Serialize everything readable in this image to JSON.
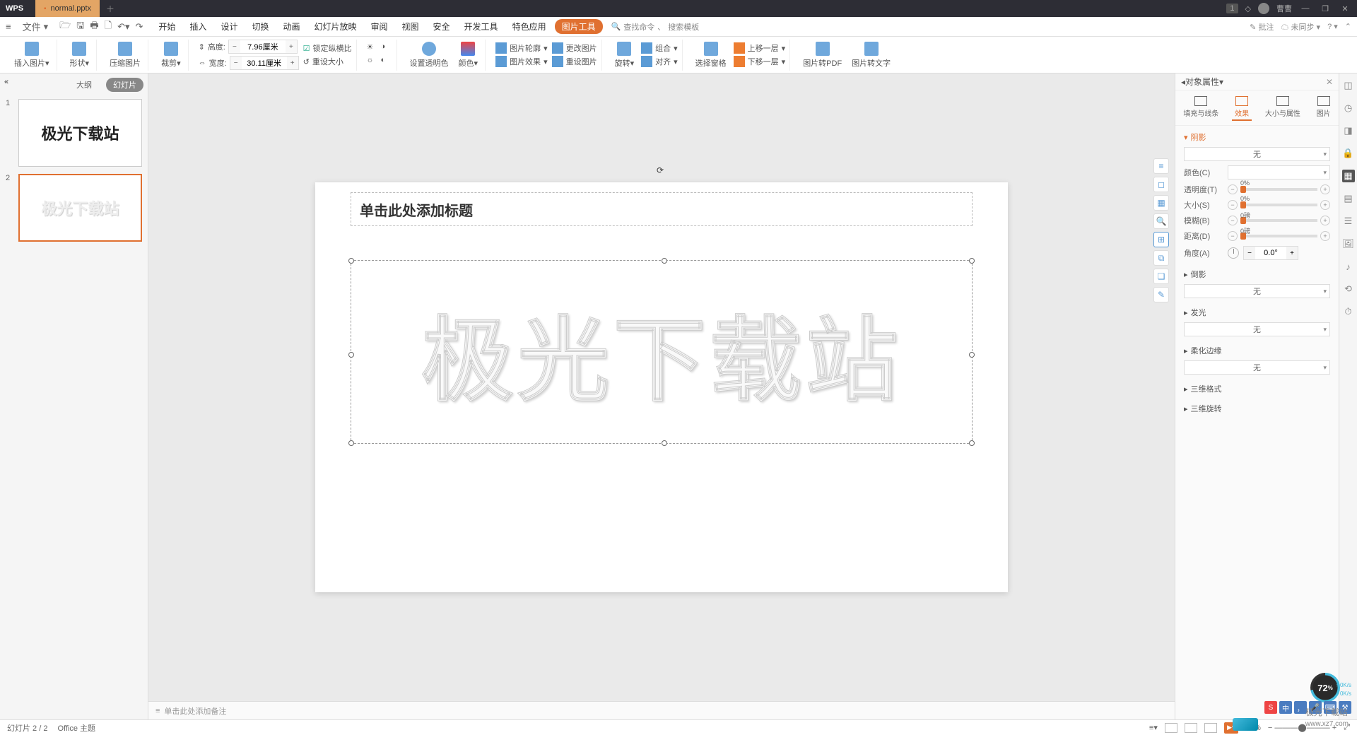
{
  "app": {
    "name": "WPS"
  },
  "titlebar": {
    "filename": "normal.pptx",
    "badge": "1",
    "user": "曹曹"
  },
  "qat": {},
  "menu": {
    "file": "文件",
    "items": [
      "开始",
      "插入",
      "设计",
      "切换",
      "动画",
      "幻灯片放映",
      "审阅",
      "视图",
      "安全",
      "开发工具",
      "特色应用",
      "图片工具"
    ],
    "active": "图片工具",
    "search1": "查找命令",
    "search2": "搜索模板",
    "annotate": "批注",
    "unsync": "未同步"
  },
  "ribbon": {
    "insertPic": "插入图片",
    "shape": "形状",
    "compress": "压缩图片",
    "crop": "裁剪",
    "heightL": "高度:",
    "heightV": "7.96厘米",
    "widthL": "宽度:",
    "widthV": "30.11厘米",
    "lockRatio": "锁定纵横比",
    "resetSize": "重设大小",
    "transparent": "设置透明色",
    "color": "颜色",
    "picOutline": "图片轮廓",
    "picEffect": "图片效果",
    "changePic": "更改图片",
    "resetPic": "重设图片",
    "rotate": "旋转",
    "combine": "组合",
    "align": "对齐",
    "selPane": "选择窗格",
    "moveUp": "上移一层",
    "moveDown": "下移一层",
    "toPDF": "图片转PDF",
    "toText": "图片转文字"
  },
  "slidepanel": {
    "outline": "大纲",
    "slides": "幻灯片",
    "thumbText": "极光下载站"
  },
  "canvas": {
    "titleph": "单击此处添加标题",
    "bigtext": "极光下载站",
    "notesph": "单击此处添加备注"
  },
  "proppanel": {
    "title": "对象属性",
    "tabs": {
      "fill": "填充与线条",
      "effect": "效果",
      "size": "大小与属性",
      "pic": "图片"
    },
    "shadow": "阴影",
    "none": "无",
    "color": "颜色(C)",
    "transparency": "透明度(T)",
    "size": "大小(S)",
    "blur": "模糊(B)",
    "distance": "距离(D)",
    "angle": "角度(A)",
    "angleV": "0.0°",
    "pct0": "0%",
    "pt0": "0磅",
    "reflection": "倒影",
    "glow": "发光",
    "softedge": "柔化边缘",
    "fmt3d": "三维格式",
    "rot3d": "三维旋转"
  },
  "status": {
    "slide": "幻灯片 2 / 2",
    "theme": "Office 主题",
    "zoom": "98%"
  },
  "overlay": {
    "gauge": "72",
    "net1": "0K/s",
    "net2": "0K/s",
    "ime": "中",
    "wmtext": "极光下载站",
    "wmurl": "www.xz7.com"
  }
}
